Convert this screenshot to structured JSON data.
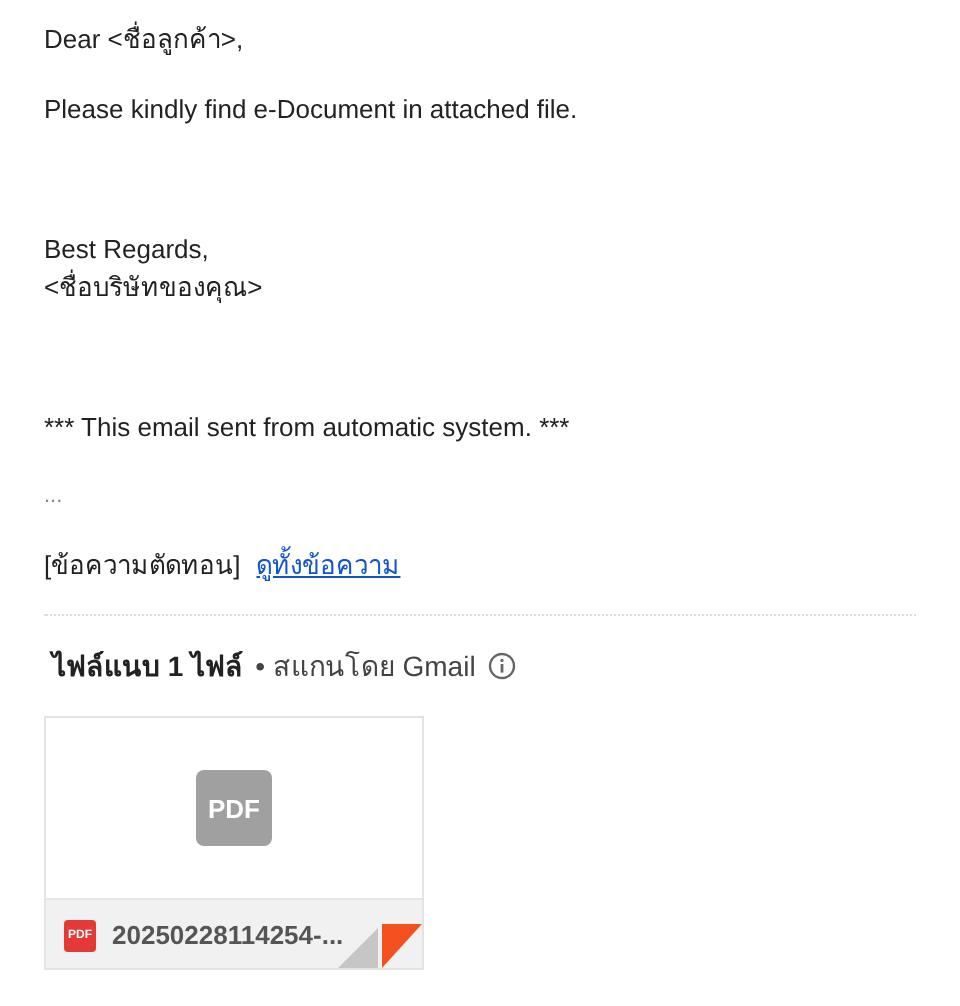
{
  "message": {
    "lines": [
      {
        "kind": "text",
        "text": "Dear <ชื่อลูกค้า>,"
      },
      {
        "kind": "text",
        "text": "Please kindly find e-Document in attached file."
      },
      {
        "kind": "gap"
      },
      {
        "kind": "text",
        "text": "Best Regards,"
      },
      {
        "kind": "tight",
        "text": "<ชื่อบริษัทของคุณ>"
      },
      {
        "kind": "gap"
      },
      {
        "kind": "text",
        "text": "*** This email sent from automatic system. ***"
      },
      {
        "kind": "dots",
        "text": "..."
      }
    ],
    "clipped": {
      "note": "[ข้อความตัดทอน]",
      "link": "ดูทั้งข้อความ"
    }
  },
  "attachments": {
    "title": "ไฟล์แนบ 1 ไฟล์",
    "scan_note": "• สแกนโดย Gmail",
    "files": [
      {
        "preview_label": "PDF",
        "type_badge": "PDF",
        "name": "20250228114254-..."
      }
    ]
  }
}
